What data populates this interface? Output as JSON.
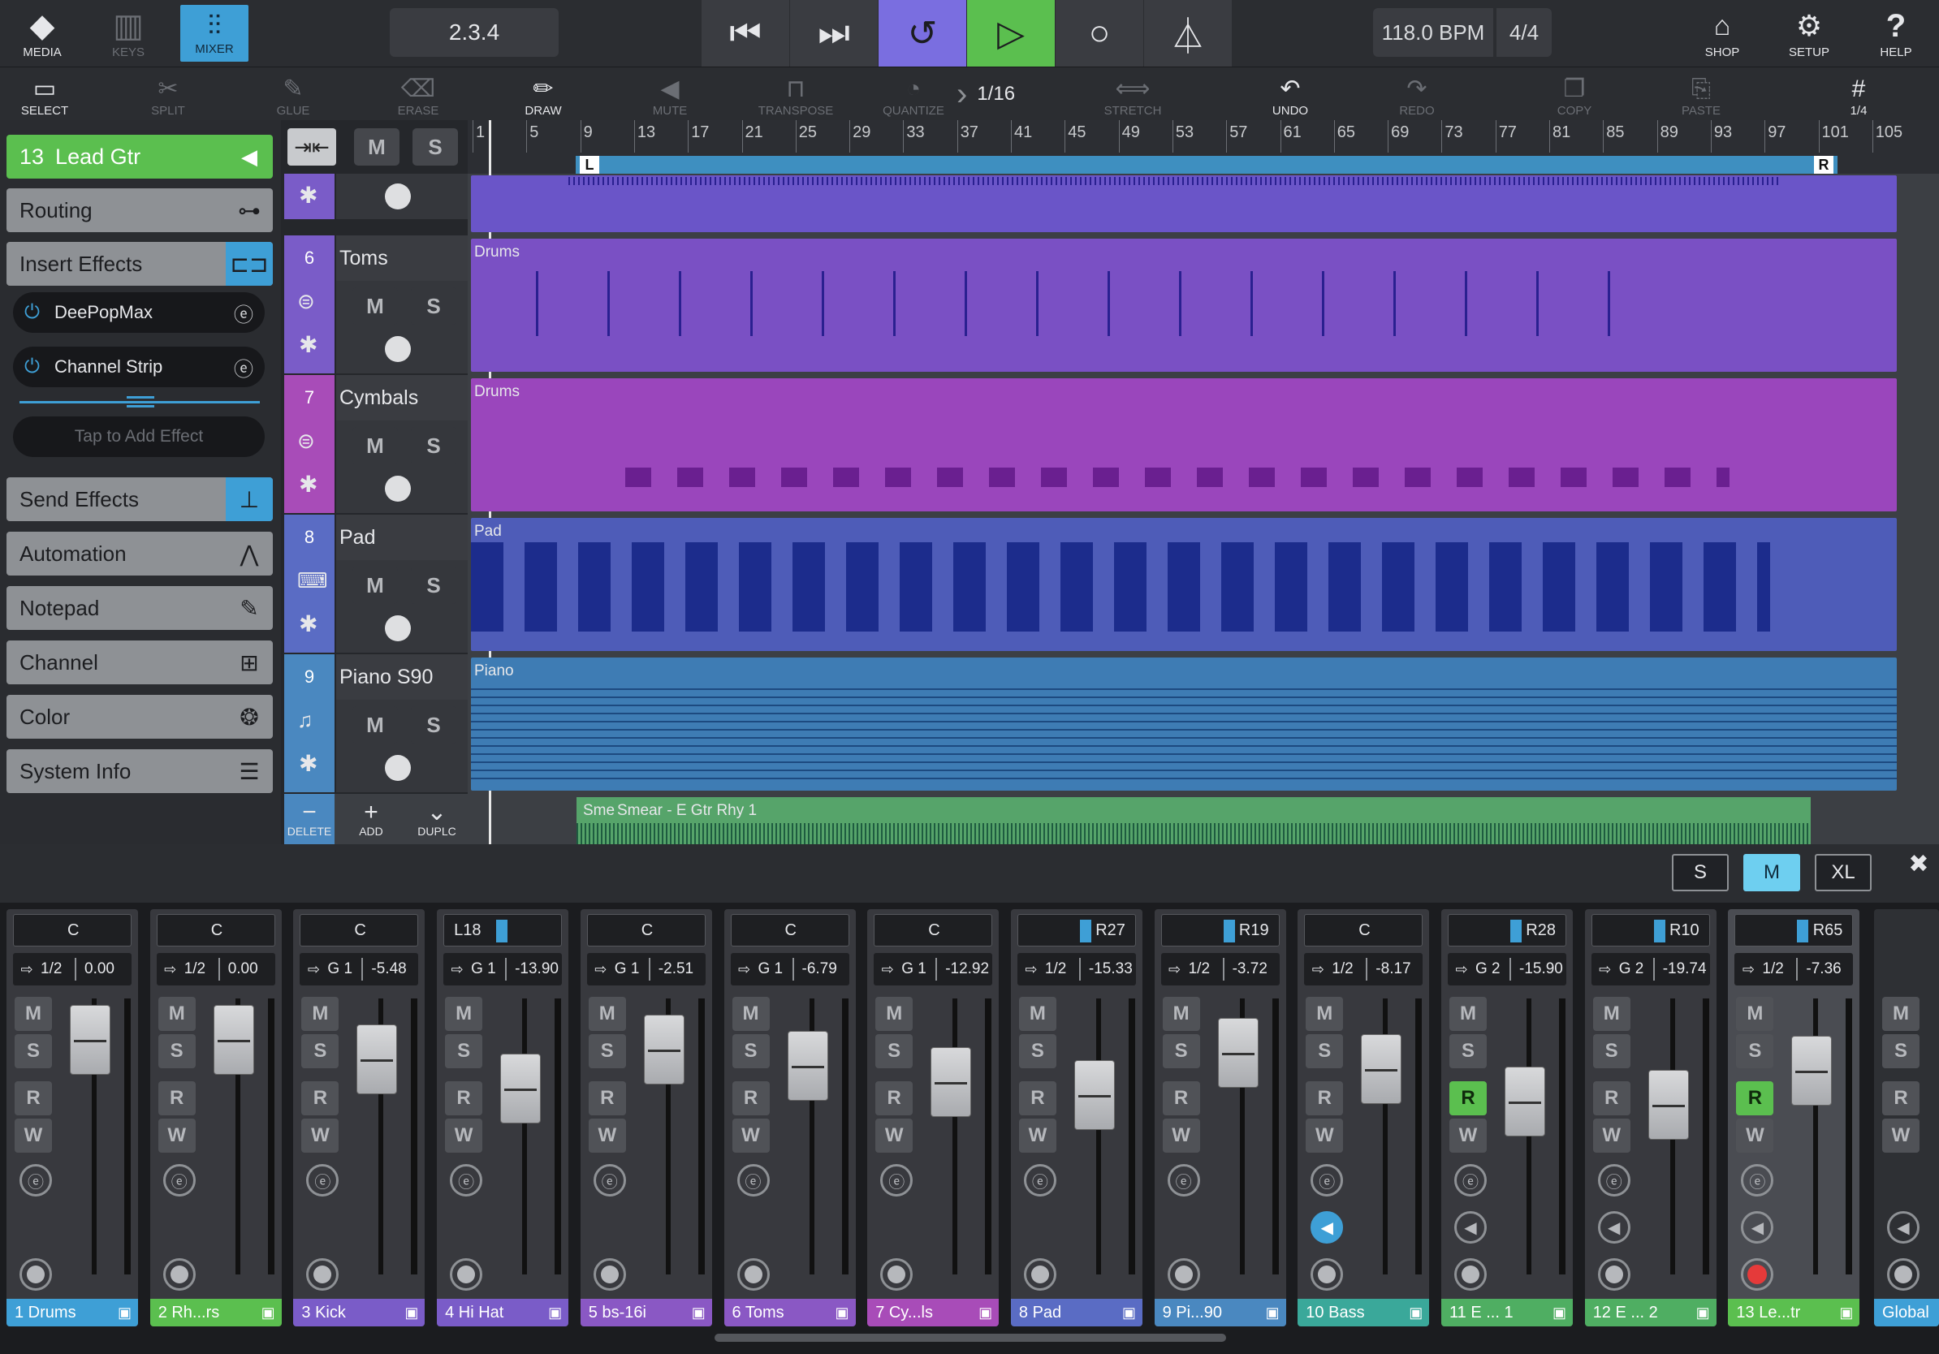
{
  "topbar": {
    "media": {
      "icon": "media-icon",
      "label": "MEDIA"
    },
    "keys": {
      "icon": "keys-icon",
      "label": "KEYS"
    },
    "mixer": {
      "icon": "mixer-icon",
      "label": "MIXER"
    },
    "position": "2.3.4",
    "bpm": "118.0 BPM",
    "signature": "4/4",
    "shop": {
      "icon": "shop-icon",
      "label": "SHOP"
    },
    "setup": {
      "icon": "gear-icon",
      "label": "SETUP"
    },
    "help": {
      "icon": "help-icon",
      "label": "HELP"
    }
  },
  "toolbar": {
    "select": "SELECT",
    "split": "SPLIT",
    "glue": "GLUE",
    "erase": "ERASE",
    "draw": "DRAW",
    "mute": "MUTE",
    "transpose": "TRANSPOSE",
    "quantize": "QUANTIZE",
    "quant_value": "1/16",
    "stretch": "STRETCH",
    "undo": "UNDO",
    "redo": "REDO",
    "copy": "COPY",
    "paste": "PASTE",
    "grid_value": "1/4"
  },
  "inspector": {
    "track_number": "13",
    "track_name": "Lead Gtr",
    "routing": "Routing",
    "insert_effects": "Insert Effects",
    "effects": [
      "DeePopMax",
      "Channel Strip"
    ],
    "add_effect": "Tap to Add Effect",
    "send_effects": "Send Effects",
    "automation": "Automation",
    "notepad": "Notepad",
    "channel": "Channel",
    "color": "Color",
    "system_info": "System Info"
  },
  "tracks": [
    {
      "num": "6",
      "name": "Toms",
      "color": "#8a58c4"
    },
    {
      "num": "7",
      "name": "Cymbals",
      "color": "#a84cb8"
    },
    {
      "num": "8",
      "name": "Pad",
      "color": "#5a6cc4"
    },
    {
      "num": "9",
      "name": "Piano S90",
      "color": "#4a88c0"
    }
  ],
  "track_buttons": {
    "m": "M",
    "s": "S",
    "delete": "DELETE",
    "add": "ADD",
    "duplicate": "DUPLC"
  },
  "ruler": [
    "1",
    "5",
    "9",
    "13",
    "17",
    "21",
    "25",
    "29",
    "33",
    "37",
    "41",
    "45",
    "49",
    "53",
    "57",
    "61",
    "65",
    "69",
    "73",
    "77",
    "81",
    "85",
    "89",
    "93",
    "97",
    "101",
    "105"
  ],
  "loop": {
    "left": "L",
    "right": "R"
  },
  "clips": {
    "drums1": "Drums",
    "drums2": "Drums",
    "pad": "Pad",
    "piano": "Piano",
    "guitar_a": "Sme",
    "guitar": "Smear - E Gtr Rhy 1"
  },
  "mixer_size": {
    "s": "S",
    "m": "M",
    "xl": "XL"
  },
  "channels": [
    {
      "pan": "C",
      "route": "1/2",
      "vol": "0.00",
      "name": "1   Drums",
      "color": "#3e9fd6",
      "icon": "drums-icon"
    },
    {
      "pan": "C",
      "route": "1/2",
      "vol": "0.00",
      "name": "2   Rh...rs",
      "color": "#5bbf4f",
      "icon": "drums-icon"
    },
    {
      "pan": "C",
      "route": "G 1",
      "vol": "-5.48",
      "name": "3   Kick",
      "color": "#7a5cc8",
      "icon": "drum-icon"
    },
    {
      "pan": "L18",
      "route": "G 1",
      "vol": "-13.90",
      "name": "4   Hi Hat",
      "color": "#7a5cc8",
      "icon": "drum-icon"
    },
    {
      "pan": "C",
      "route": "G 1",
      "vol": "-2.51",
      "name": "5   bs-16i",
      "color": "#8a58c4",
      "icon": "keyboard-icon"
    },
    {
      "pan": "C",
      "route": "G 1",
      "vol": "-6.79",
      "name": "6   Toms",
      "color": "#8a58c4",
      "icon": "drum-icon"
    },
    {
      "pan": "C",
      "route": "G 1",
      "vol": "-12.92",
      "name": "7   Cy...ls",
      "color": "#a84cb8",
      "icon": "drum-icon"
    },
    {
      "pan": "R27",
      "route": "1/2",
      "vol": "-15.33",
      "name": "8   Pad",
      "color": "#5a6cc4",
      "icon": "synth-icon"
    },
    {
      "pan": "R19",
      "route": "1/2",
      "vol": "-3.72",
      "name": "9   Pi...90",
      "color": "#4a88c0",
      "icon": "piano-icon"
    },
    {
      "pan": "C",
      "route": "1/2",
      "vol": "-8.17",
      "name": "10   Bass",
      "color": "#3aa89a",
      "icon": "bass-icon"
    },
    {
      "pan": "R28",
      "route": "G 2",
      "vol": "-15.90",
      "name": "11   E ... 1",
      "color": "#4fae62",
      "icon": "play-icon"
    },
    {
      "pan": "R10",
      "route": "G 2",
      "vol": "-19.74",
      "name": "12   E ... 2",
      "color": "#4fae62",
      "icon": "play-icon"
    },
    {
      "pan": "R65",
      "route": "1/2",
      "vol": "-7.36",
      "name": "13   Le...tr",
      "color": "#5bbf4f",
      "icon": "play-icon"
    }
  ],
  "global": {
    "m": "M",
    "s": "S",
    "r": "R",
    "w": "W",
    "name": "Global"
  },
  "strip_buttons": {
    "m": "M",
    "s": "S",
    "r": "R",
    "w": "W"
  }
}
